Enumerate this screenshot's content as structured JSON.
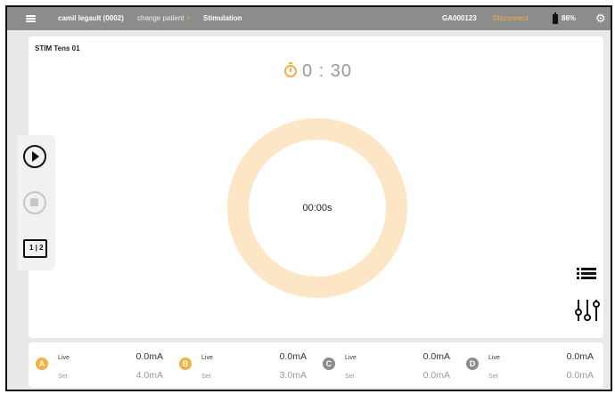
{
  "topbar": {
    "patient": "camil legault (0002)",
    "change_patient": "change patient",
    "change_chevron": ">",
    "page": "Stimulation",
    "device_id": "GA000123",
    "disconnect": "Disconnect",
    "battery": "86%",
    "settings_icon": "gear-icon",
    "menu_icon": "hamburger-icon"
  },
  "main": {
    "program_name": "STIM Tens 01",
    "timer": "0 : 30",
    "elapsed": "00:00s",
    "ring_color": "#fce6c6",
    "accent_color": "#f5b042"
  },
  "sidepanel": {
    "play_icon": "play-icon",
    "stop_icon": "stop-icon",
    "layout_label": "1 | 2"
  },
  "channels": [
    {
      "id": "A",
      "color": "#f5b042",
      "live_label": "Live",
      "live_value": "0.0mA",
      "set_label": "Set",
      "set_value": "4.0mA"
    },
    {
      "id": "B",
      "color": "#f5b042",
      "live_label": "Live",
      "live_value": "0.0mA",
      "set_label": "Set",
      "set_value": "3.0mA"
    },
    {
      "id": "C",
      "color": "#8c8c8c",
      "live_label": "Live",
      "live_value": "0.0mA",
      "set_label": "Set",
      "set_value": "0.0mA"
    },
    {
      "id": "D",
      "color": "#8c8c8c",
      "live_label": "Live",
      "live_value": "0.0mA",
      "set_label": "Set",
      "set_value": "0.0mA"
    }
  ]
}
